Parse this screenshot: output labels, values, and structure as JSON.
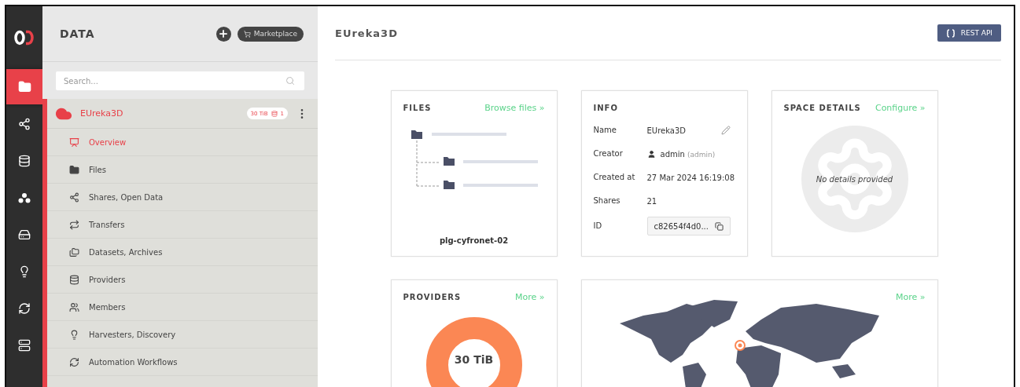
{
  "rail": {
    "items": [
      {
        "kind": "folder",
        "selected": true
      },
      {
        "kind": "share",
        "selected": false
      },
      {
        "kind": "database",
        "selected": false
      },
      {
        "kind": "cluster",
        "selected": false
      },
      {
        "kind": "drive",
        "selected": false
      },
      {
        "kind": "bulb",
        "selected": false
      },
      {
        "kind": "workflow",
        "selected": false
      },
      {
        "kind": "server",
        "selected": false
      }
    ]
  },
  "sidebar": {
    "title": "DATA",
    "marketplace": "Marketplace",
    "search": {
      "placeholder": "Search..."
    },
    "space": {
      "name": "EUreka3D",
      "size": "30 TiB",
      "providers": "1"
    },
    "items": [
      {
        "kind": "overview",
        "label": "Overview",
        "selected": true
      },
      {
        "kind": "files",
        "label": "Files",
        "selected": false
      },
      {
        "kind": "share",
        "label": "Shares, Open Data",
        "selected": false
      },
      {
        "kind": "transfers",
        "label": "Transfers",
        "selected": false
      },
      {
        "kind": "datasets",
        "label": "Datasets, Archives",
        "selected": false
      },
      {
        "kind": "providers",
        "label": "Providers",
        "selected": false
      },
      {
        "kind": "members",
        "label": "Members",
        "selected": false
      },
      {
        "kind": "bulb",
        "label": "Harvesters, Discovery",
        "selected": false
      },
      {
        "kind": "workflow",
        "label": "Automation Workflows",
        "selected": false
      }
    ]
  },
  "main": {
    "title": "EUreka3D",
    "rest_button": "REST API",
    "files_card": {
      "title": "FILES",
      "link": "Browse files »",
      "provider": "plg-cyfronet-02"
    },
    "info_card": {
      "title": "INFO",
      "rows": [
        {
          "kind": "name",
          "label": "Name",
          "value": "EUreka3D"
        },
        {
          "kind": "creator",
          "label": "Creator",
          "value": "admin",
          "note": "(admin)"
        },
        {
          "kind": "plain",
          "label": "Created at",
          "value": "27 Mar 2024 16:19:08"
        },
        {
          "kind": "plain",
          "label": "Shares",
          "value": "21"
        },
        {
          "kind": "id",
          "label": "ID",
          "value": "c82654f4d0..."
        }
      ]
    },
    "details_card": {
      "title": "SPACE DETAILS",
      "link": "Configure »",
      "empty": "No details provided"
    },
    "providers_card": {
      "title": "PROVIDERS",
      "link": "More »",
      "total": "30 TiB"
    },
    "map_card": {
      "link": "More »"
    }
  }
}
